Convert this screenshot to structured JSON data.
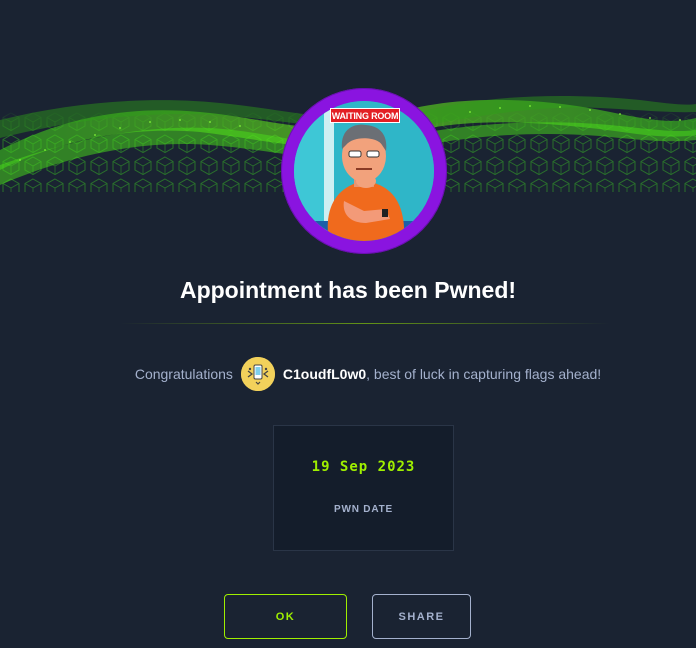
{
  "banner": {
    "accent_color": "#9fef00",
    "background_color": "#1a2332"
  },
  "machine": {
    "avatar_ring_color": "#8a14e0",
    "avatar_sign_text": "WAITING ROOM"
  },
  "title": "Appointment has been Pwned!",
  "congrats": {
    "prefix": "Congratulations",
    "username": "C1oudfL0w0",
    "suffix": ", best of luck in capturing flags ahead!"
  },
  "pwn": {
    "date": "19 Sep 2023",
    "label": "PWN DATE"
  },
  "buttons": {
    "ok_label": "OK",
    "share_label": "SHARE"
  }
}
